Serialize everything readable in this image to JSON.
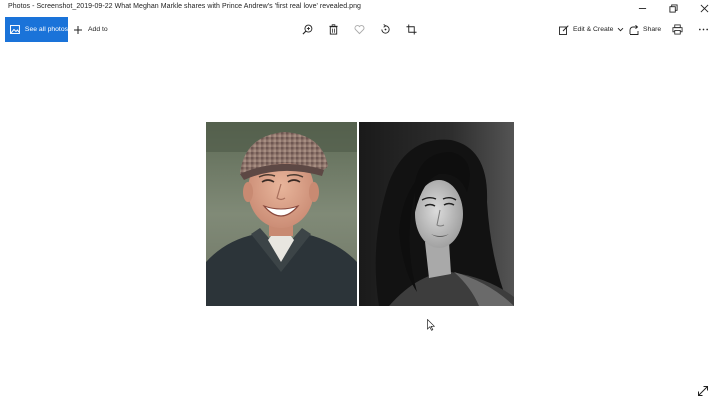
{
  "window": {
    "title": "Photos - Screenshot_2019-09-22 What Meghan Markle shares with Prince Andrew's 'first real love' revealed.png",
    "controls": [
      "minimize-icon",
      "restore-icon",
      "close-icon"
    ]
  },
  "toolbar": {
    "see_all_label": "See all photos",
    "add_to_label": "Add to",
    "edit_create_label": "Edit & Create",
    "share_label": "Share",
    "icons": [
      "zoom-icon",
      "delete-icon",
      "favorite-icon",
      "rotate-icon",
      "crop-icon",
      "print-icon",
      "more-icon"
    ]
  },
  "colors": {
    "accent": "#1a73d9",
    "background": "#ffffff"
  }
}
